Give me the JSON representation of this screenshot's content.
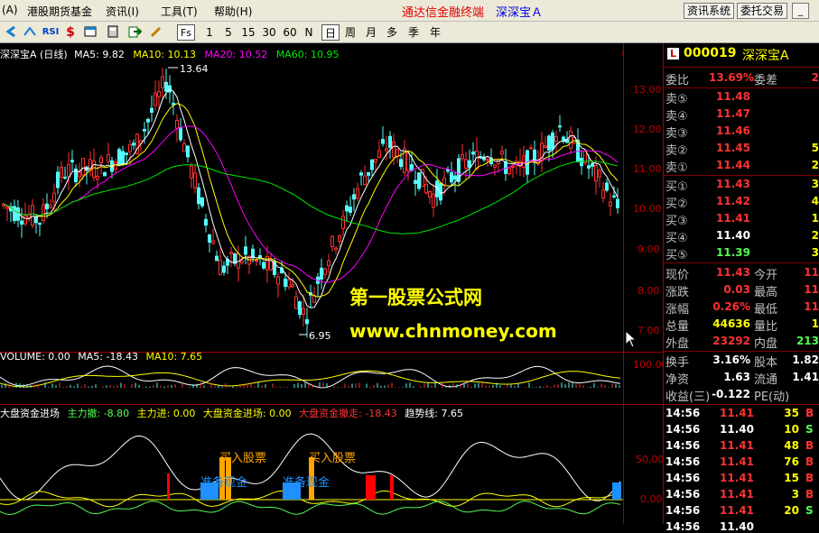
{
  "menubar": {
    "items": [
      "(A)",
      "港股期货基金",
      "资讯(I)",
      "工具(T)",
      "帮助(H)"
    ],
    "app_title": "通达信金融终端",
    "stock_title": "深深宝Ａ",
    "buttons": [
      "资讯系统",
      "委托交易"
    ],
    "window_controls": [
      "_",
      "□",
      "×"
    ]
  },
  "toolbar": {
    "periods": [
      "1",
      "5",
      "15",
      "30",
      "60",
      "N",
      "日",
      "周",
      "月",
      "多",
      "季",
      "年"
    ],
    "active_period": "日",
    "rsi_label": "RSI",
    "fs_label": "Fs"
  },
  "main_chart": {
    "title": "深深宝A (日线)",
    "ma5": "MA5: 9.82",
    "ma10": "MA10: 10.13",
    "ma20": "MA20: 10.52",
    "ma60": "MA60: 10.95",
    "high_label": "13.64",
    "low_label": "6.95",
    "axis": [
      "13.00",
      "12.00",
      "11.00",
      "10.00",
      "9.00",
      "8.00",
      "7.00"
    ],
    "colors": {
      "up": "#FF3232",
      "down": "#54FCFC",
      "ma5": "#FFFFFF",
      "ma10": "#FFFF00",
      "ma20": "#FF00FF",
      "ma60": "#00E600"
    }
  },
  "volume_chart": {
    "title": "VOLUME: 0.00",
    "ma5": "MA5: -18.43",
    "ma10": "MA10: 7.65",
    "axis": [
      "100.00"
    ]
  },
  "indicator_chart": {
    "title": "大盘资金进场",
    "main_out": "主力撤: -8.80",
    "main_in": "主力进: 0.00",
    "big_in": "大盘资金进场: 0.00",
    "big_out": "大盘资金撤走: -18.43",
    "trend": "趋势线: 7.65",
    "buy_label": "买入股票",
    "prepare_label_1": "准备现金",
    "prepare_label_2": "准备现金",
    "axis": [
      "50.00",
      "0.00"
    ]
  },
  "watermark": {
    "line1": "第一股票公式网",
    "line2": "www.chnmoney.com"
  },
  "quote": {
    "code_badge": "L",
    "code": "000019",
    "name": "深深宝A",
    "wb_label": "委比",
    "wb_value": "13.69%",
    "wc_label": "委差",
    "wc_value": "2",
    "sells": [
      {
        "label": "卖⑤",
        "price": "11.48"
      },
      {
        "label": "卖④",
        "price": "11.47"
      },
      {
        "label": "卖③",
        "price": "11.46"
      },
      {
        "label": "卖②",
        "price": "11.45",
        "vol": "5"
      },
      {
        "label": "卖①",
        "price": "11.44",
        "vol": "2"
      }
    ],
    "buys": [
      {
        "label": "买①",
        "price": "11.43",
        "vol": "3"
      },
      {
        "label": "买②",
        "price": "11.42",
        "vol": "4"
      },
      {
        "label": "买③",
        "price": "11.41",
        "vol": "1"
      },
      {
        "label": "买④",
        "price": "11.40",
        "vol": "2"
      },
      {
        "label": "买⑤",
        "price": "11.39",
        "vol": "3"
      }
    ],
    "stats": [
      {
        "l1": "现价",
        "v1": "11.43",
        "c1": "#FF3232",
        "l2": "今开",
        "v2": "11",
        "c2": "#FF3232"
      },
      {
        "l1": "涨跌",
        "v1": "0.03",
        "c1": "#FF3232",
        "l2": "最高",
        "v2": "11",
        "c2": "#FF3232"
      },
      {
        "l1": "涨幅",
        "v1": "0.26%",
        "c1": "#FF3232",
        "l2": "最低",
        "v2": "11",
        "c2": "#FF3232"
      },
      {
        "l1": "总量",
        "v1": "44636",
        "c1": "#FFFF00",
        "l2": "量比",
        "v2": "1",
        "c2": "#FFFF00"
      },
      {
        "l1": "外盘",
        "v1": "23292",
        "c1": "#FF3232",
        "l2": "内盘",
        "v2": "213",
        "c2": "#54FC54"
      }
    ],
    "stats2": [
      {
        "l1": "换手",
        "v1": "3.16%",
        "l2": "股本",
        "v2": "1.82"
      },
      {
        "l1": "净资",
        "v1": "1.63",
        "l2": "流通",
        "v2": "1.41"
      },
      {
        "l1": "收益(三)",
        "v1": "-0.122",
        "l2": "PE(动)",
        "v2": ""
      }
    ],
    "trades": [
      {
        "time": "14:56",
        "price": "11.41",
        "vol": "35",
        "side": "B"
      },
      {
        "time": "14:56",
        "price": "11.40",
        "vol": "10",
        "side": "S"
      },
      {
        "time": "14:56",
        "price": "11.41",
        "vol": "48",
        "side": "B"
      },
      {
        "time": "14:56",
        "price": "11.41",
        "vol": "76",
        "side": "B"
      },
      {
        "time": "14:56",
        "price": "11.41",
        "vol": "15",
        "side": "B"
      },
      {
        "time": "14:56",
        "price": "11.41",
        "vol": "3",
        "side": "B"
      },
      {
        "time": "14:56",
        "price": "11.41",
        "vol": "20",
        "side": "S"
      },
      {
        "time": "14:56",
        "price": "11.40",
        "vol": "",
        "side": ""
      }
    ]
  }
}
